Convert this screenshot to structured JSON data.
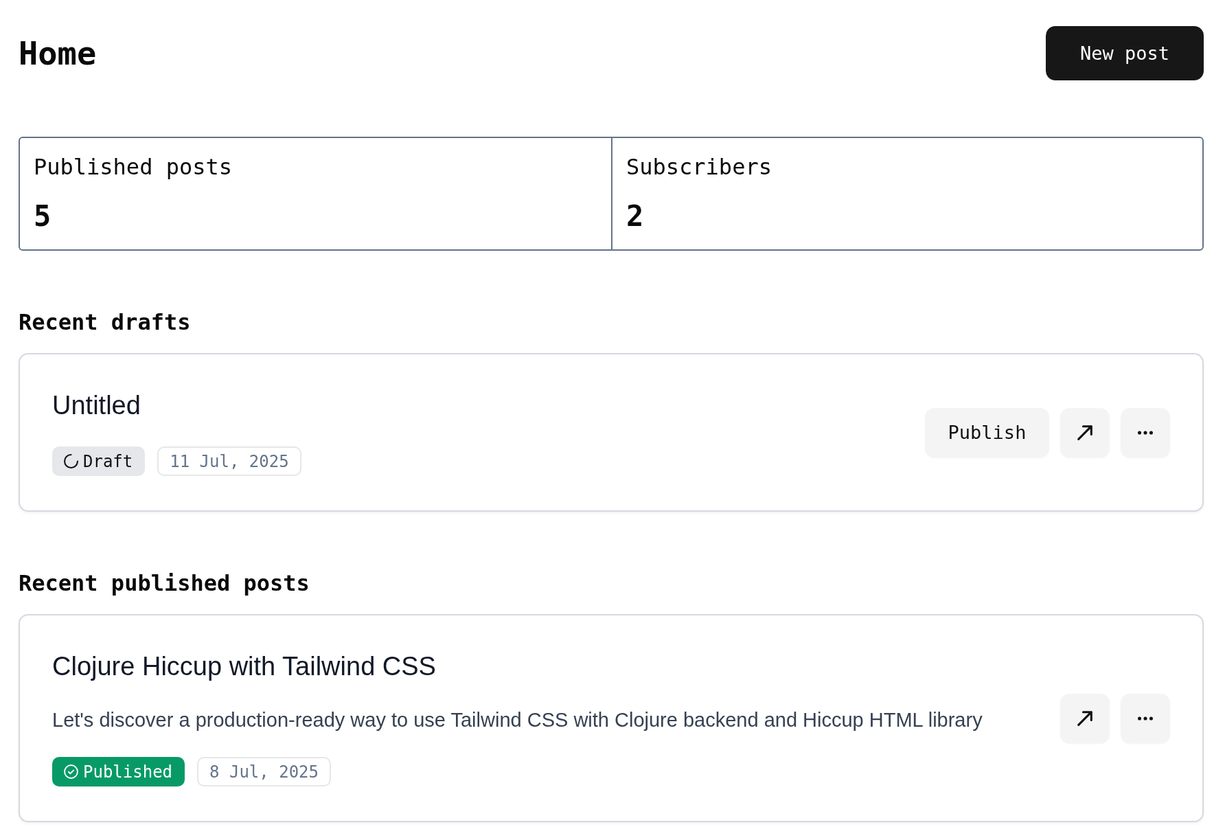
{
  "header": {
    "title": "Home",
    "new_post_button": "New post"
  },
  "stats": [
    {
      "label": "Published posts",
      "value": "5"
    },
    {
      "label": "Subscribers",
      "value": "2"
    }
  ],
  "sections": [
    {
      "heading": "Recent drafts",
      "posts": [
        {
          "title": "Untitled",
          "status": {
            "kind": "draft",
            "label": "Draft"
          },
          "date": "11 Jul, 2025",
          "publish_button": "Publish"
        }
      ]
    },
    {
      "heading": "Recent published posts",
      "posts": [
        {
          "title": "Clojure Hiccup with Tailwind CSS",
          "description": "Let's discover a production-ready way to use Tailwind CSS with Clojure backend and Hiccup HTML library",
          "status": {
            "kind": "published",
            "label": "Published"
          },
          "date": "8 Jul, 2025"
        }
      ]
    }
  ]
}
